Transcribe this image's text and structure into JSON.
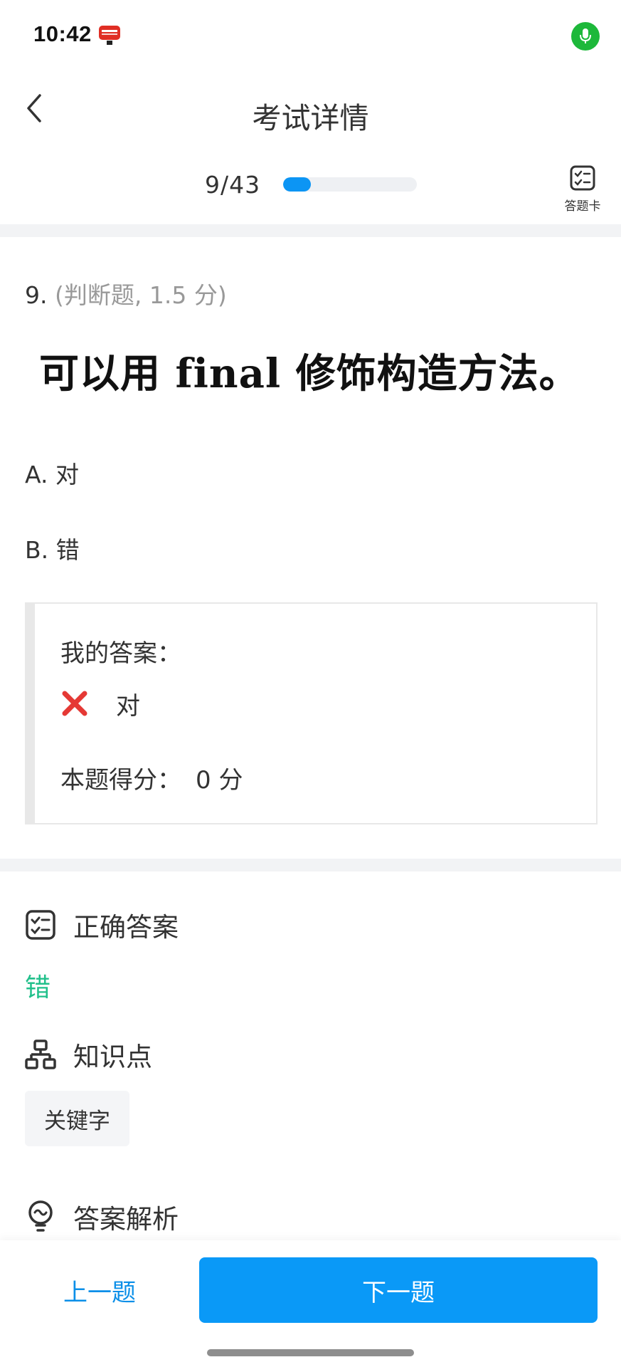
{
  "status_bar": {
    "time": "10:42"
  },
  "nav": {
    "title": "考试详情"
  },
  "progress": {
    "text": "9/43",
    "fraction": 0.209,
    "answer_card_label": "答题卡"
  },
  "question": {
    "number": "9.",
    "meta": "(判断题, 1.5 分)",
    "text": "可以用 final 修饰构造方法。",
    "options": [
      {
        "label": "A. 对"
      },
      {
        "label": "B. 错"
      }
    ]
  },
  "my_answer": {
    "title": "我的答案：",
    "value": "对",
    "score_label": "本题得分：",
    "score_value": "0 分"
  },
  "correct": {
    "header": "正确答案",
    "value": "错"
  },
  "knowledge": {
    "header": "知识点",
    "tags": [
      "关键字"
    ]
  },
  "analysis": {
    "header": "答案解析"
  },
  "footer": {
    "prev_label": "上一题",
    "next_label": "下一题"
  },
  "colors": {
    "accent": "#0a99f7",
    "correct": "#21c08b",
    "wrong_mark": "#e53935",
    "mic": "#1db83a"
  },
  "icons": {
    "back": "chevron-left-icon",
    "answer_card": "checklist-icon",
    "wrong": "cross-mark-icon",
    "correct_answer": "checklist-icon",
    "knowledge": "hierarchy-icon",
    "analysis": "lightbulb-icon",
    "mic": "microphone-icon"
  }
}
